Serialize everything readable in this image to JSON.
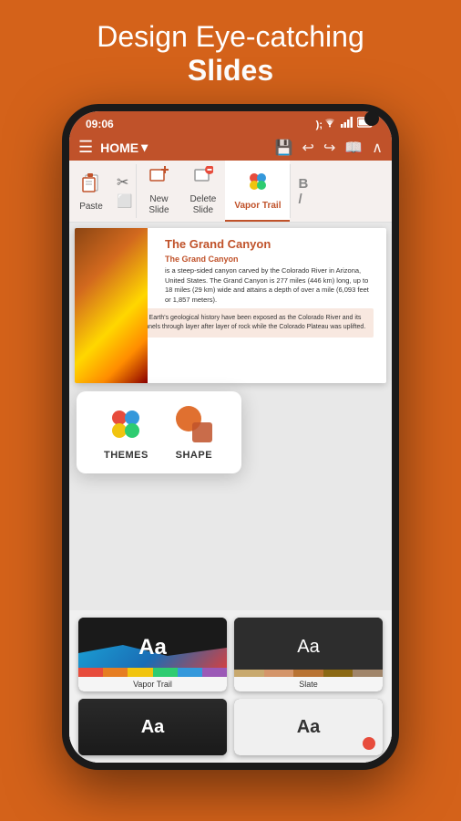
{
  "header": {
    "line1": "Design Eye-catching",
    "line2": "Slides"
  },
  "statusBar": {
    "time": "09:06",
    "icons": "WiFi signal battery"
  },
  "toolbar": {
    "menuLabel": "☰",
    "homeLabel": "HOME",
    "dropdownArrow": "▾",
    "icons": [
      "💾",
      "↩",
      "↪",
      "📖",
      "∧"
    ]
  },
  "ribbon": {
    "items": [
      {
        "label": "Paste",
        "icon": "📋"
      },
      {
        "label": "",
        "icon": "✂"
      },
      {
        "label": "New\nSlide",
        "icon": "🖼"
      },
      {
        "label": "Delete\nSlide",
        "icon": "🖼"
      },
      {
        "label": "Themes",
        "icon": "🎨"
      }
    ],
    "extraButtons": [
      "B",
      "/"
    ]
  },
  "slide": {
    "title": "The Grand ",
    "titleAccent": "Canyon",
    "subtitleAccent": "The Grand Canyon",
    "body1": "is a steep-sided canyon carved by the Colorado River in Arizona, United States. The Grand Canyon is 277 miles (446 km) long, up to 18 miles (29 km) wide and attains a depth of over a mile (6,093 feet or 1,857 meters).",
    "body2": "two billion years of Earth's geological history have been exposed as the Colorado River and its tributaries cut channels through layer after layer of rock while the Colorado Plateau was uplifted."
  },
  "popupMenu": {
    "items": [
      {
        "label": "THEMES",
        "iconType": "dots"
      },
      {
        "label": "SHAPE",
        "iconType": "shapes"
      }
    ]
  },
  "themeCards": {
    "row1": [
      {
        "label": "Vapor Trail",
        "aaText": "Aa",
        "style": "vapor"
      },
      {
        "label": "Slate",
        "aaText": "Aa",
        "style": "slate"
      }
    ],
    "row2": [
      {
        "label": "",
        "aaText": "Aa",
        "style": "dark"
      },
      {
        "label": "",
        "aaText": "Aa",
        "style": "light"
      }
    ]
  },
  "colors": {
    "brand": "#C0522A",
    "orange": "#D4621A",
    "background": "#D4621A"
  }
}
